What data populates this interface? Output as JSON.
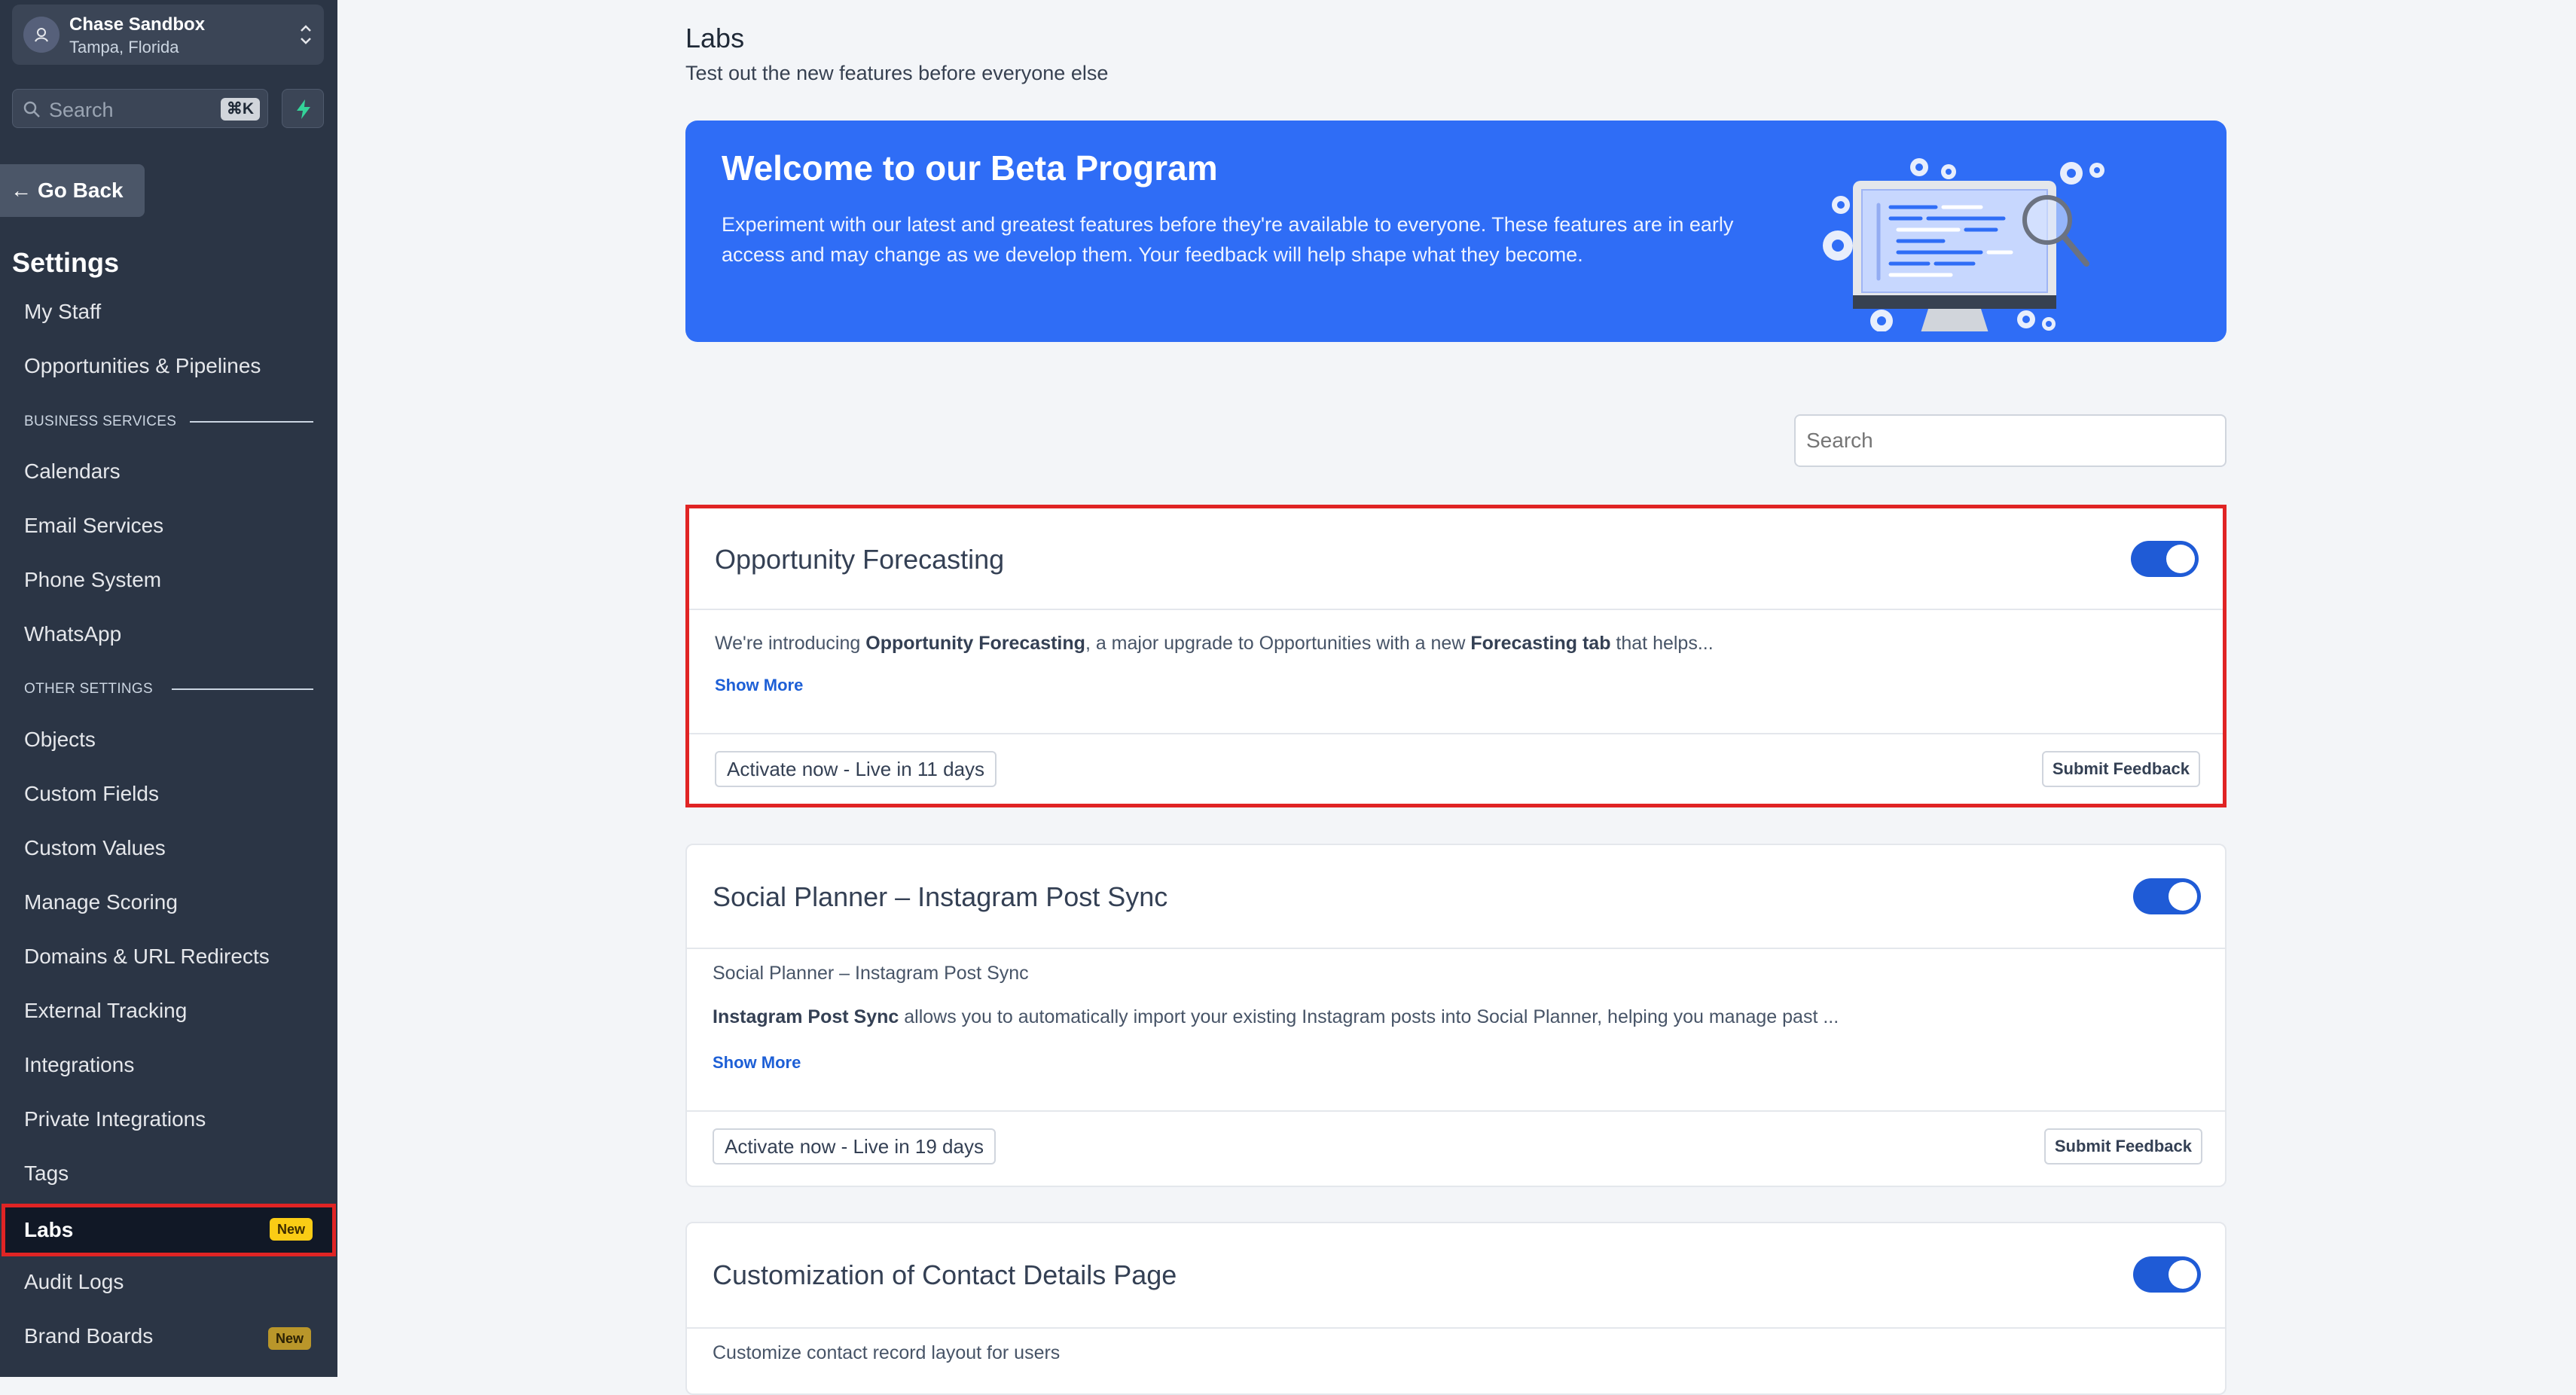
{
  "account": {
    "name": "Chase Sandbox",
    "location": "Tampa, Florida"
  },
  "sidebar": {
    "search_placeholder": "Search",
    "search_shortcut": "⌘K",
    "go_back": "Go Back",
    "settings_title": "Settings",
    "items_top": [
      "My Staff",
      "Opportunities & Pipelines"
    ],
    "section_business": "BUSINESS SERVICES",
    "items_business": [
      "Calendars",
      "Email Services",
      "Phone System",
      "WhatsApp"
    ],
    "section_other": "OTHER SETTINGS",
    "items_other": [
      "Objects",
      "Custom Fields",
      "Custom Values",
      "Manage Scoring",
      "Domains & URL Redirects",
      "External Tracking",
      "Integrations",
      "Private Integrations",
      "Tags"
    ],
    "labs_label": "Labs",
    "labs_badge": "New",
    "items_bottom": [
      "Audit Logs",
      "Brand Boards"
    ],
    "brand_badge": "New"
  },
  "page": {
    "title": "Labs",
    "subtitle": "Test out the new features before everyone else"
  },
  "banner": {
    "title": "Welcome to our Beta Program",
    "text": "Experiment with our latest and greatest features before they're available to everyone. These features are in early access and may change as we develop them. Your feedback will help shape what they become."
  },
  "search": {
    "placeholder": "Search"
  },
  "cards": [
    {
      "title": "Opportunity Forecasting",
      "enabled": true,
      "desc_1": "We're introducing ",
      "desc_b1": "Opportunity Forecasting",
      "desc_2": ", a major upgrade to Opportunities with a new ",
      "desc_b2": "Forecasting tab",
      "desc_3": " that helps...",
      "show_more": "Show More",
      "activate": "Activate now - Live in 11 days",
      "feedback": "Submit Feedback"
    },
    {
      "title": "Social Planner – Instagram Post Sync",
      "enabled": true,
      "subtitle": "Social Planner – Instagram Post Sync",
      "desc_b1": "Instagram Post Sync",
      "desc_2": " allows you to automatically import your existing Instagram posts into Social Planner, helping you manage past ...",
      "show_more": "Show More",
      "activate": "Activate now - Live in 19 days",
      "feedback": "Submit Feedback"
    },
    {
      "title": "Customization of Contact Details Page",
      "enabled": true,
      "subtitle": "Customize contact record layout for users"
    }
  ],
  "colors": {
    "sidebar": "#2b3545",
    "accent": "#2f6df6",
    "toggle": "#1f5bd6",
    "highlight": "#e02424",
    "badge": "#facc15"
  }
}
